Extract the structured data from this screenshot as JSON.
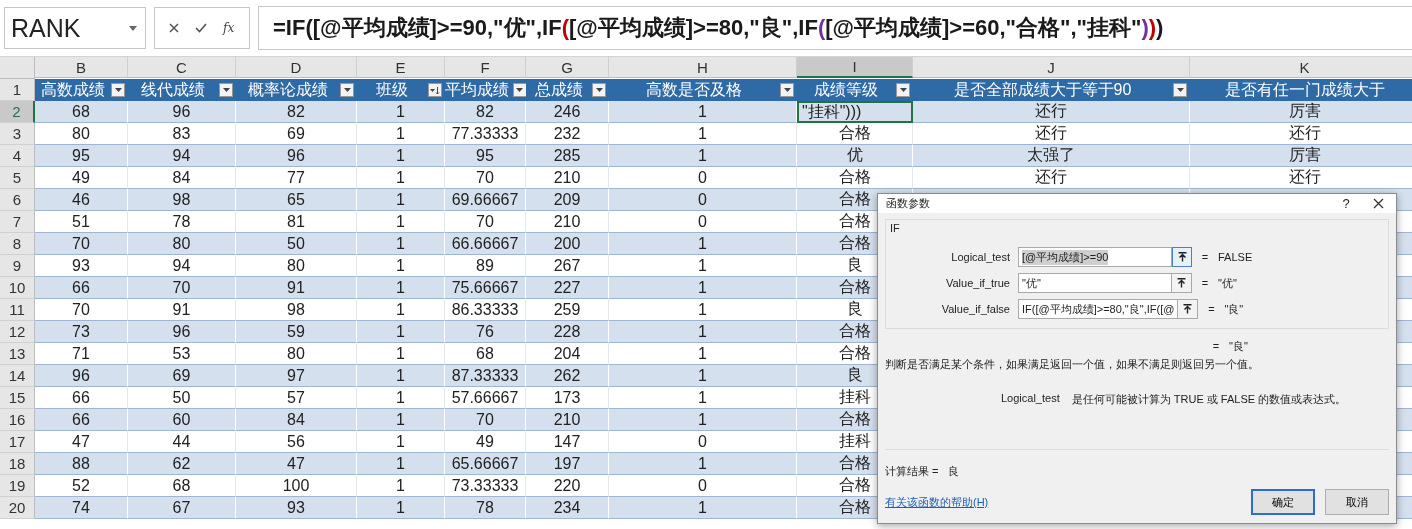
{
  "formula_bar": {
    "name_box": "RANK",
    "fx": "fx",
    "formula_segments": [
      {
        "text": "=IF([@平均成绩]>=90,\"优\",IF",
        "color": "#1a1a1a"
      },
      {
        "text": "(",
        "color": "#c00000"
      },
      {
        "text": "[@平均成绩]>=80,\"良\",IF",
        "color": "#1a1a1a"
      },
      {
        "text": "(",
        "color": "#7030a0"
      },
      {
        "text": "[@平均成绩]>=60,\"合格\",\"挂科\"",
        "color": "#1a1a1a"
      },
      {
        "text": ")",
        "color": "#7030a0"
      },
      {
        "text": ")",
        "color": "#c00000"
      },
      {
        "text": ")",
        "color": "#1a1a1a"
      }
    ]
  },
  "sheet": {
    "row_header_1": "1",
    "columns": [
      {
        "letter": "B",
        "header": "高数成绩",
        "filter_button": true,
        "sorted": false,
        "selected": false
      },
      {
        "letter": "C",
        "header": "线代成绩",
        "filter_button": true,
        "sorted": false,
        "selected": false
      },
      {
        "letter": "D",
        "header": "概率论成绩",
        "filter_button": true,
        "sorted": false,
        "selected": false
      },
      {
        "letter": "E",
        "header": "班级",
        "filter_button": true,
        "sorted": true,
        "selected": false
      },
      {
        "letter": "F",
        "header": "平均成绩",
        "filter_button": true,
        "sorted": false,
        "selected": false
      },
      {
        "letter": "G",
        "header": "总成绩",
        "filter_button": true,
        "sorted": false,
        "selected": false
      },
      {
        "letter": "H",
        "header": "高数是否及格",
        "filter_button": true,
        "sorted": false,
        "selected": false
      },
      {
        "letter": "I",
        "header": "成绩等级",
        "filter_button": true,
        "sorted": false,
        "selected": true
      },
      {
        "letter": "J",
        "header": "是否全部成绩大于等于90",
        "filter_button": true,
        "sorted": false,
        "selected": false
      },
      {
        "letter": "K",
        "header": "是否有任一门成绩大于",
        "filter_button": false,
        "selected": false
      }
    ],
    "rows": [
      {
        "number": "2",
        "selected": true,
        "cells": [
          "68",
          "96",
          "82",
          "1",
          "82",
          "246",
          "1",
          "\"挂科\")))",
          "还行",
          "厉害"
        ]
      },
      {
        "number": "3",
        "selected": false,
        "cells": [
          "80",
          "83",
          "69",
          "1",
          "77.33333",
          "232",
          "1",
          "合格",
          "还行",
          "还行"
        ]
      },
      {
        "number": "4",
        "selected": false,
        "cells": [
          "95",
          "94",
          "96",
          "1",
          "95",
          "285",
          "1",
          "优",
          "太强了",
          "厉害"
        ]
      },
      {
        "number": "5",
        "selected": false,
        "cells": [
          "49",
          "84",
          "77",
          "1",
          "70",
          "210",
          "0",
          "合格",
          "还行",
          "还行"
        ]
      },
      {
        "number": "6",
        "selected": false,
        "cells": [
          "46",
          "98",
          "65",
          "1",
          "69.66667",
          "209",
          "0",
          "合格"
        ]
      },
      {
        "number": "7",
        "selected": false,
        "cells": [
          "51",
          "78",
          "81",
          "1",
          "70",
          "210",
          "0",
          "合格"
        ]
      },
      {
        "number": "8",
        "selected": false,
        "cells": [
          "70",
          "80",
          "50",
          "1",
          "66.66667",
          "200",
          "1",
          "合格"
        ]
      },
      {
        "number": "9",
        "selected": false,
        "cells": [
          "93",
          "94",
          "80",
          "1",
          "89",
          "267",
          "1",
          "良"
        ]
      },
      {
        "number": "10",
        "selected": false,
        "cells": [
          "66",
          "70",
          "91",
          "1",
          "75.66667",
          "227",
          "1",
          "合格"
        ]
      },
      {
        "number": "11",
        "selected": false,
        "cells": [
          "70",
          "91",
          "98",
          "1",
          "86.33333",
          "259",
          "1",
          "良"
        ]
      },
      {
        "number": "12",
        "selected": false,
        "cells": [
          "73",
          "96",
          "59",
          "1",
          "76",
          "228",
          "1",
          "合格"
        ]
      },
      {
        "number": "13",
        "selected": false,
        "cells": [
          "71",
          "53",
          "80",
          "1",
          "68",
          "204",
          "1",
          "合格"
        ]
      },
      {
        "number": "14",
        "selected": false,
        "cells": [
          "96",
          "69",
          "97",
          "1",
          "87.33333",
          "262",
          "1",
          "良"
        ]
      },
      {
        "number": "15",
        "selected": false,
        "cells": [
          "66",
          "50",
          "57",
          "1",
          "57.66667",
          "173",
          "1",
          "挂科"
        ]
      },
      {
        "number": "16",
        "selected": false,
        "cells": [
          "66",
          "60",
          "84",
          "1",
          "70",
          "210",
          "1",
          "合格"
        ]
      },
      {
        "number": "17",
        "selected": false,
        "cells": [
          "47",
          "44",
          "56",
          "1",
          "49",
          "147",
          "0",
          "挂科"
        ]
      },
      {
        "number": "18",
        "selected": false,
        "cells": [
          "88",
          "62",
          "47",
          "1",
          "65.66667",
          "197",
          "1",
          "合格"
        ]
      },
      {
        "number": "19",
        "selected": false,
        "cells": [
          "52",
          "68",
          "100",
          "1",
          "73.33333",
          "220",
          "0",
          "合格"
        ]
      },
      {
        "number": "20",
        "selected": false,
        "cells": [
          "74",
          "67",
          "93",
          "1",
          "78",
          "234",
          "1",
          "合格"
        ]
      }
    ]
  },
  "dialog": {
    "title": "函数参数",
    "help": "?",
    "function_name": "IF",
    "arguments": [
      {
        "label": "Logical_test",
        "value": "[@平均成绩]>=90",
        "text_selected": true,
        "equals": "=",
        "result": "FALSE"
      },
      {
        "label": "Value_if_true",
        "value": "\"优\"",
        "text_selected": false,
        "equals": "=",
        "result": "\"优\""
      },
      {
        "label": "Value_if_false",
        "value": "IF([@平均成绩]>=80,\"良\",IF([@",
        "text_selected": false,
        "equals": "=",
        "result": "\"良\""
      }
    ],
    "overall_equals": "=",
    "overall_result": "\"良\"",
    "description": "判断是否满足某个条件，如果满足返回一个值，如果不满足则返回另一个值。",
    "argument_name": "Logical_test",
    "argument_description": "是任何可能被计算为 TRUE 或 FALSE 的数值或表达式。",
    "result_label": "计算结果 =",
    "result_value": "良",
    "help_link": "有关该函数的帮助(H)",
    "buttons": [
      {
        "label": "确定",
        "default": true
      },
      {
        "label": "取消",
        "default": false
      }
    ]
  }
}
